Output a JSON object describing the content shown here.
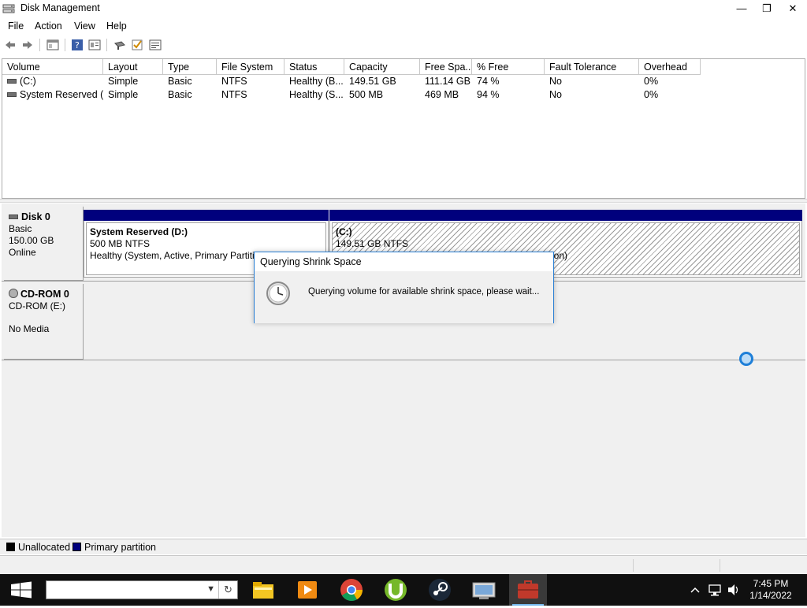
{
  "window": {
    "title": "Disk Management",
    "controls": [
      "—",
      "❐",
      "✕"
    ]
  },
  "menu": [
    "File",
    "Action",
    "View",
    "Help"
  ],
  "volume_list": {
    "columns": [
      "Volume",
      "Layout",
      "Type",
      "File System",
      "Status",
      "Capacity",
      "Free Spa...",
      "% Free",
      "Fault Tolerance",
      "Overhead"
    ],
    "rows": [
      [
        "(C:)",
        "Simple",
        "Basic",
        "NTFS",
        "Healthy (B...",
        "149.51 GB",
        "111.14 GB",
        "74 %",
        "No",
        "0%"
      ],
      [
        "System Reserved (...",
        "Simple",
        "Basic",
        "NTFS",
        "Healthy (S...",
        "500 MB",
        "469 MB",
        "94 %",
        "No",
        "0%"
      ]
    ]
  },
  "disks": [
    {
      "name": "Disk 0",
      "type": "Basic",
      "size": "150.00 GB",
      "state": "Online",
      "partitions": [
        {
          "name": "System Reserved  (D:)",
          "size": "500 MB NTFS",
          "status": "Healthy (System, Active, Primary Partiti"
        },
        {
          "name": "(C:)",
          "size": "149.51 GB NTFS",
          "status": "ion)"
        }
      ]
    },
    {
      "name": "CD-ROM 0",
      "type": "CD-ROM (E:)",
      "state": "No Media"
    }
  ],
  "legend": [
    {
      "label": "Unallocated",
      "color": "#000000"
    },
    {
      "label": "Primary partition",
      "color": "#00007d"
    }
  ],
  "dialog": {
    "title": "Querying Shrink Space",
    "message": "Querying volume for available shrink space, please wait..."
  },
  "taskbar": {
    "apps": [
      "file-explorer-icon",
      "media-player-icon",
      "chrome-icon",
      "utorrent-icon",
      "steam-icon",
      "computer-management-icon",
      "disk-management-icon"
    ],
    "time": "7:45 PM",
    "date": "1/14/2022"
  },
  "colors": {
    "partition_header": "#00007d",
    "dialog_border": "#2a7fd4",
    "taskbar": "#101010"
  }
}
